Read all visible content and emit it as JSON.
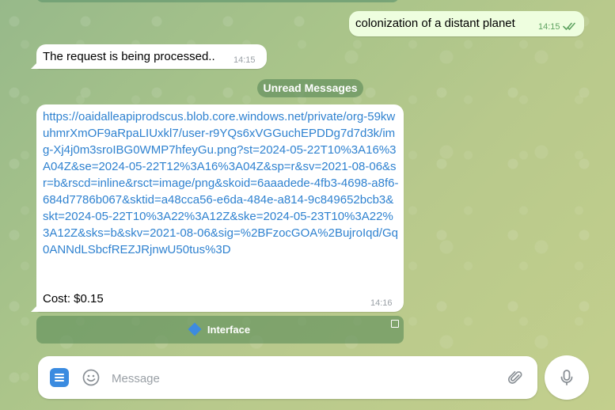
{
  "colors": {
    "accent": "#3a8be0",
    "link": "#2f82d0",
    "outgoing_bubble": "#eefedf",
    "read_ticks": "#5fa361"
  },
  "messages": {
    "outgoing": {
      "text": "colonization of a distant planet",
      "time": "14:15",
      "status_icon": "double-check-icon"
    },
    "incoming_status": {
      "text": "The request is being processed..",
      "time": "14:15"
    },
    "incoming_result": {
      "link": "https://oaidalleapiprodscus.blob.core.windows.net/private/org-59kwuhmrXmOF9aRpaLIUxkl7/user-r9YQs6xVGGuchEPDDg7d7d3k/img-Xj4j0m3sroIBG0WMP7hfeyGu.png?st=2024-05-22T10%3A16%3A04Z&se=2024-05-22T12%3A16%3A04Z&sp=r&sv=2021-08-06&sr=b&rscd=inline&rsct=image/png&skoid=6aaadede-4fb3-4698-a8f6-684d7786b067&sktid=a48cca56-e6da-484e-a814-9c849652bcb3&skt=2024-05-22T10%3A22%3A12Z&ske=2024-05-23T10%3A22%3A12Z&sks=b&skv=2021-08-06&sig=%2BFzocGOA%2BujroIqd/Gq0ANNdLSbcfREZJRjnwU50tus%3D",
      "cost": "Cost: $0.15",
      "time": "14:16"
    }
  },
  "unread_divider": "Unread Messages",
  "inline_keyboard": {
    "button_label": "Interface",
    "button_icon": "blue-diamond-icon"
  },
  "composer": {
    "placeholder": "Message",
    "value": ""
  }
}
